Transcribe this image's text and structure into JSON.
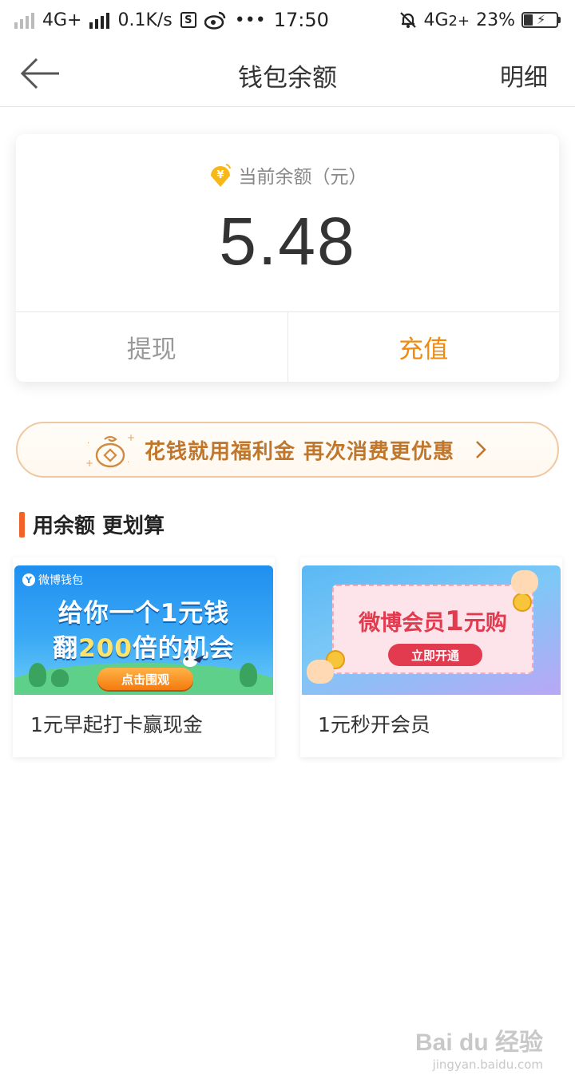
{
  "status_bar": {
    "network1": "4G+",
    "speed": "0.1K/s",
    "s_icon_label": "S",
    "more": "•••",
    "time": "17:50",
    "network2": "4G",
    "network2_sub": "2+",
    "battery_percent": "23%",
    "icons": [
      "signal-icon",
      "weibo-icon",
      "mute-bell-icon",
      "battery-charging-icon"
    ]
  },
  "nav": {
    "title": "钱包余额",
    "detail": "明细",
    "back_icon": "back-arrow-icon"
  },
  "balance": {
    "label": "当前余额（元）",
    "value": "5.48",
    "withdraw": "提现",
    "recharge": "充值",
    "accent": "#f08a10"
  },
  "banner": {
    "text": "花钱就用福利金 再次消费更优惠",
    "color": "#c0772c"
  },
  "section": {
    "title": "用余额 更划算",
    "bar_color": "#f2632a"
  },
  "promos": [
    {
      "brand": "微博钱包",
      "brand_mark": "Y",
      "line1": "给你一个1元钱",
      "line2a": "翻",
      "line2b": "200",
      "line2c": "倍的机会",
      "button": "点击围观",
      "caption": "1元早起打卡赢现金"
    },
    {
      "line1a": "微博会员",
      "line1b": "1",
      "line1c": "元购",
      "button": "立即开通",
      "caption": "1元秒开会员"
    }
  ],
  "watermark": {
    "line1": "Bai du 经验",
    "line2": "jingyan.baidu.com"
  }
}
